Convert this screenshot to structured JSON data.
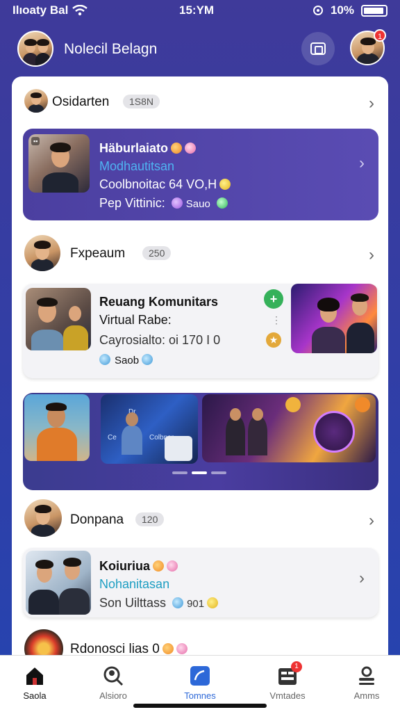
{
  "status_bar": {
    "carrier": "Ilıoaty Bal",
    "time": "15:YM",
    "battery": "10%"
  },
  "header": {
    "title": "Nolecil Belagn",
    "profile_badge": "1"
  },
  "sections": [
    {
      "name": "Osidarten",
      "count": "1S8N",
      "card": {
        "title": "Häburlaiato",
        "subtitle": "Modhautitsan",
        "line3": "Coolbnoitac 64 VO,H",
        "line4_label": "Pep Vittinic:",
        "line4_value": "Sauo"
      }
    },
    {
      "name": "Fxpeaum",
      "count": "250",
      "card": {
        "title": "Reuang Komunitars",
        "subtitle": "Virtual Rabe:",
        "line3": "Cayrosialto: oi 170 I 0",
        "footer": "Saob"
      }
    },
    {
      "name": "Donpana",
      "count": "120",
      "card": {
        "title": "Koiuriua",
        "subtitle": "Nohanitasan",
        "line3": "Son Uilttass",
        "line3_value": "901"
      }
    },
    {
      "name": "Rdonosci lias 0"
    }
  ],
  "banner": {
    "text1": "Dr",
    "text2": "Ce",
    "text3": "Colbnar"
  },
  "bottom_nav": {
    "items": [
      {
        "label": "Saola",
        "icon": "home-icon"
      },
      {
        "label": "Alsioro",
        "icon": "search-user-icon"
      },
      {
        "label": "Tomnes",
        "icon": "compose-icon"
      },
      {
        "label": "Vmtades",
        "icon": "dashboard-icon",
        "badge": "1"
      },
      {
        "label": "Amms",
        "icon": "profile-icon"
      }
    ]
  },
  "colors": {
    "accent": "#2d68d8",
    "card_purple": "#4b3fa0",
    "background": "#3f3a9a"
  }
}
